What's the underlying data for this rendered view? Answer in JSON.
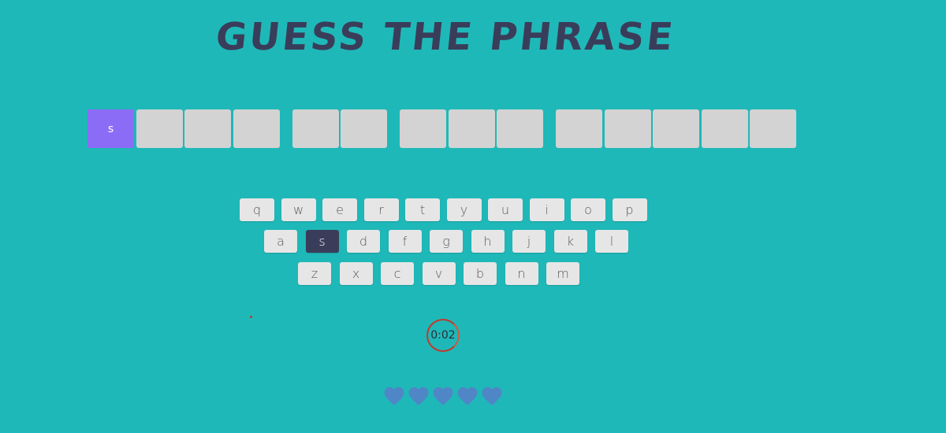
{
  "title": "GUESS THE PHRASE",
  "phrase": {
    "words": [
      [
        "s",
        "",
        "",
        ""
      ],
      [
        "",
        ""
      ],
      [
        "",
        "",
        ""
      ],
      [
        "",
        "",
        "",
        "",
        ""
      ]
    ]
  },
  "keyboard": {
    "rows": [
      [
        "q",
        "w",
        "e",
        "r",
        "t",
        "y",
        "u",
        "i",
        "o",
        "p"
      ],
      [
        "a",
        "s",
        "d",
        "f",
        "g",
        "h",
        "j",
        "k",
        "l"
      ],
      [
        "z",
        "x",
        "c",
        "v",
        "b",
        "n",
        "m"
      ]
    ],
    "used": [
      "s"
    ]
  },
  "timer": {
    "value": "0:02"
  },
  "lives": {
    "remaining": 5,
    "total": 5,
    "icon": "heart-icon",
    "color": "#4f86c6"
  },
  "colors": {
    "background": "#1fb8b8",
    "revealed_tile": "#8b6cf6",
    "used_key": "#3a3d5a",
    "timer_ring": "#c0392b"
  }
}
